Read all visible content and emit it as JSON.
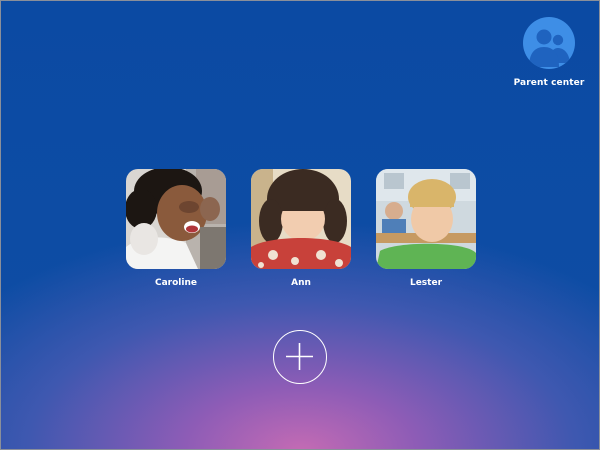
{
  "parent_center": {
    "label": "Parent center",
    "icon": "parent-users-icon"
  },
  "profiles": [
    {
      "name": "Caroline",
      "photo": "child-photo-caroline"
    },
    {
      "name": "Ann",
      "photo": "child-photo-ann"
    },
    {
      "name": "Lester",
      "photo": "child-photo-lester"
    }
  ],
  "add_profile": {
    "icon": "plus-icon"
  },
  "colors": {
    "background_top": "#0b4aa3",
    "background_glow": "#c46bb4",
    "parent_avatar": "#3e8ee6",
    "text": "#ffffff"
  }
}
